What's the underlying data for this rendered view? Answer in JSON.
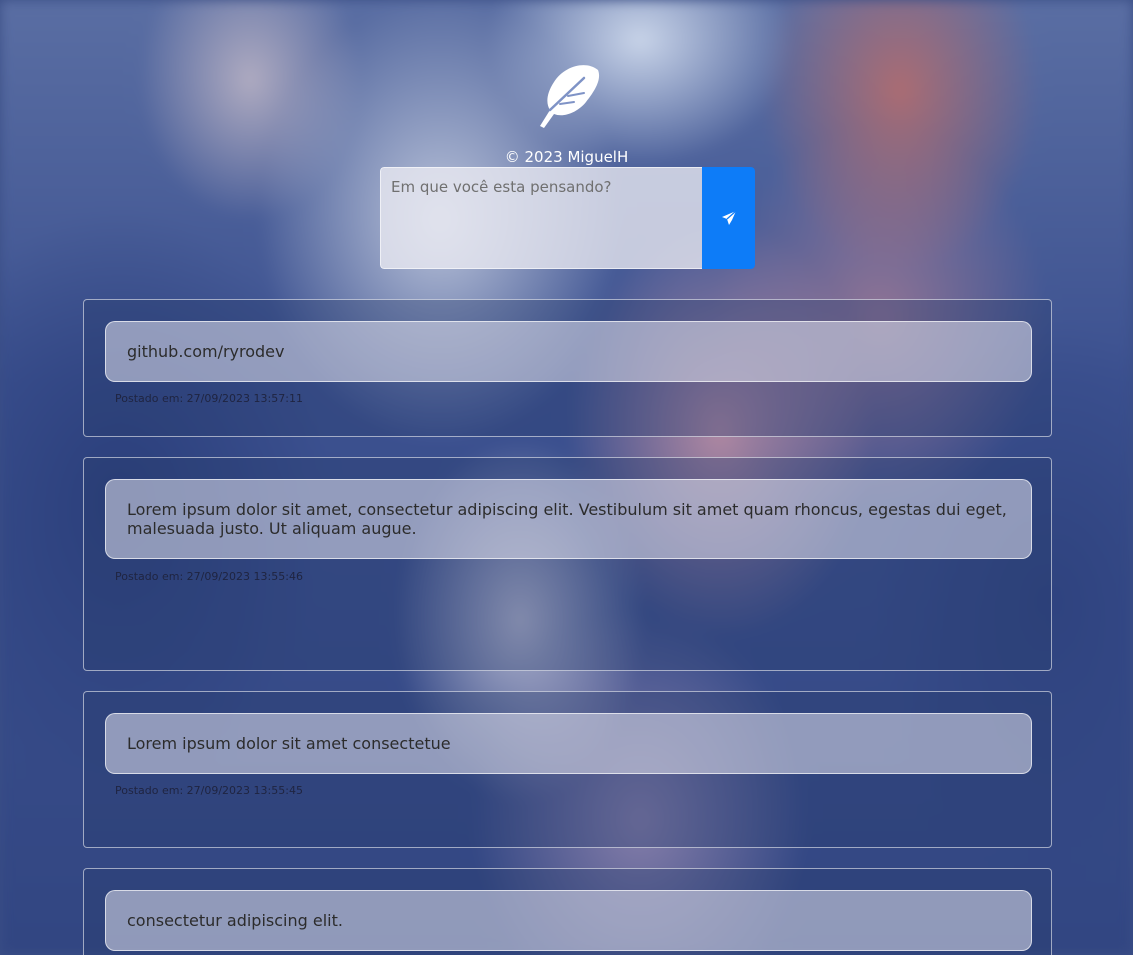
{
  "footer": {
    "copyright": "© 2023 MiguelH"
  },
  "composer": {
    "placeholder": "Em que você esta pensando?",
    "send_icon": "paper-plane-icon"
  },
  "logo_icon": "feather-icon",
  "posts": [
    {
      "text": "github.com/ryrodev",
      "date": "Postado em: 27/09/2023 13:57:11"
    },
    {
      "text": "Lorem ipsum dolor sit amet, consectetur adipiscing elit. Vestibulum sit amet quam rhoncus, egestas dui eget, malesuada justo. Ut aliquam augue.",
      "date": "Postado em: 27/09/2023 13:55:46"
    },
    {
      "text": "Lorem ipsum dolor sit amet consectetue",
      "date": "Postado em: 27/09/2023 13:55:45"
    },
    {
      "text": "consectetur adipiscing elit.",
      "date": ""
    }
  ],
  "colors": {
    "send_button": "#0d7cf8"
  }
}
